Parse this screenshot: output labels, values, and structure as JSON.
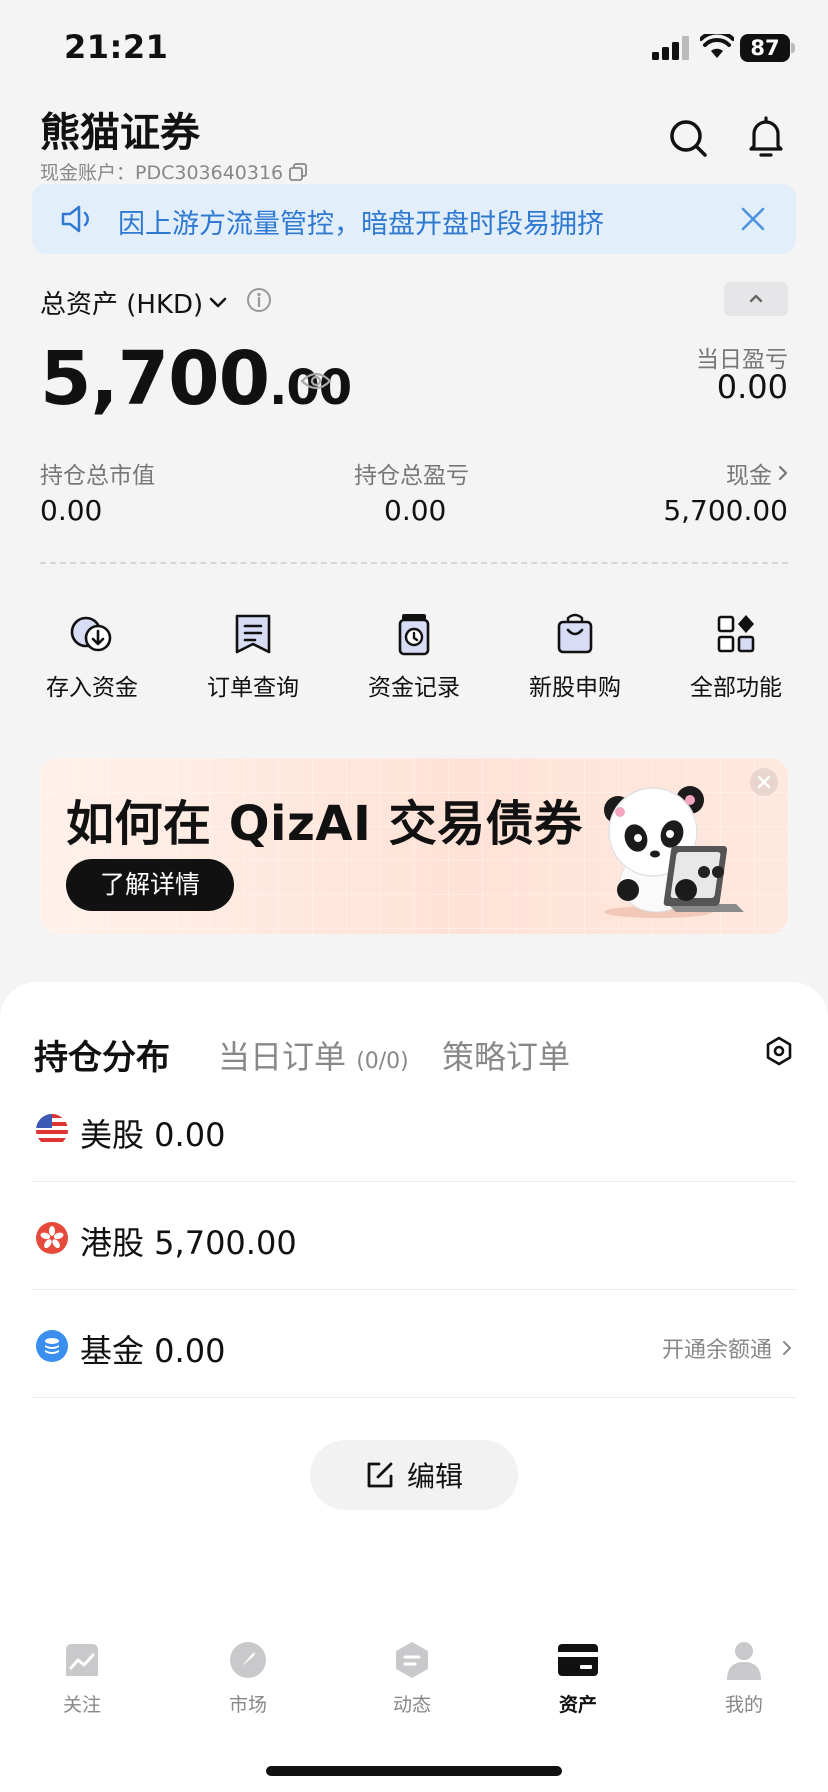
{
  "status_bar": {
    "time": "21:21",
    "battery": "87"
  },
  "header": {
    "title": "熊猫证券",
    "account_label": "现金账户：PDC303640316"
  },
  "notice": {
    "text": "因上游方流量管控，暗盘开盘时段易拥挤"
  },
  "assets": {
    "total_label": "总资产 (HKD)",
    "total_int": "5,700",
    "total_dec": ".00",
    "day_pl_label": "当日盈亏",
    "day_pl_value": "0.00",
    "market_value_label": "持仓总市值",
    "market_value": "0.00",
    "position_pl_label": "持仓总盈亏",
    "position_pl": "0.00",
    "cash_label": "现金",
    "cash_value": "5,700.00"
  },
  "quick_actions": [
    {
      "label": "存入资金",
      "icon": "deposit-icon"
    },
    {
      "label": "订单查询",
      "icon": "receipt-icon"
    },
    {
      "label": "资金记录",
      "icon": "record-icon"
    },
    {
      "label": "新股申购",
      "icon": "shopping-bag-icon"
    },
    {
      "label": "全部功能",
      "icon": "grid-icon"
    }
  ],
  "banner": {
    "title": "如何在 QizAI 交易债券",
    "button": "了解详情"
  },
  "holdings": {
    "tabs": [
      {
        "label": "持仓分布"
      },
      {
        "label": "当日订单",
        "count": "(0/0)"
      },
      {
        "label": "策略订单"
      }
    ],
    "rows": [
      {
        "label": "美股 0.00",
        "icon": "us-flag-icon"
      },
      {
        "label": "港股 5,700.00",
        "icon": "hk-flag-icon"
      },
      {
        "label": "基金 0.00",
        "icon": "fund-icon"
      }
    ],
    "fund_link": "开通余额通",
    "edit_label": "编辑"
  },
  "tabbar": [
    {
      "label": "关注"
    },
    {
      "label": "市场"
    },
    {
      "label": "动态"
    },
    {
      "label": "资产"
    },
    {
      "label": "我的"
    }
  ],
  "colors": {
    "accent_blue": "#2f79d2",
    "notice_bg": "#e3eefb",
    "text": "#111111",
    "muted": "#888888"
  }
}
